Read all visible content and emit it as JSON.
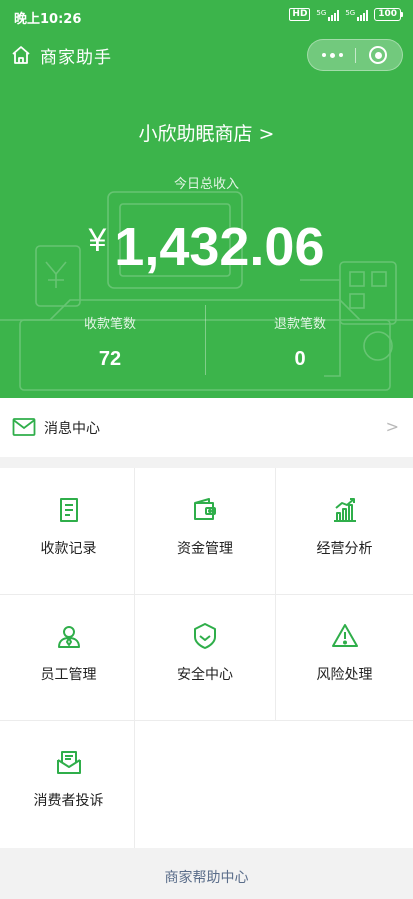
{
  "status_bar": {
    "time": "晚上10:26",
    "hd": "HD",
    "network1": "5G",
    "network2": "5G",
    "battery": "100"
  },
  "nav": {
    "title": "商家助手"
  },
  "summary": {
    "store_name": "小欣助眠商店",
    "store_chevron": ">",
    "income_label": "今日总收入",
    "currency": "¥",
    "income_amount": "1,432.06",
    "received_label": "收款笔数",
    "received_count": "72",
    "refund_label": "退款笔数",
    "refund_count": "0"
  },
  "message_center": {
    "label": "消息中心",
    "chevron": ">"
  },
  "features": {
    "items": [
      {
        "label": "收款记录",
        "icon": "receipt-icon"
      },
      {
        "label": "资金管理",
        "icon": "wallet-icon"
      },
      {
        "label": "经营分析",
        "icon": "bar-chart-icon"
      },
      {
        "label": "员工管理",
        "icon": "staff-icon"
      },
      {
        "label": "安全中心",
        "icon": "shield-icon"
      },
      {
        "label": "风险处理",
        "icon": "warning-icon"
      },
      {
        "label": "消费者投诉",
        "icon": "complaint-mail-icon"
      }
    ]
  },
  "footer": {
    "help_label": "商家帮助中心"
  },
  "colors": {
    "brand_green": "#3cb44b",
    "icon_green": "#2fae4a",
    "link_blue": "#5a6d8a"
  }
}
